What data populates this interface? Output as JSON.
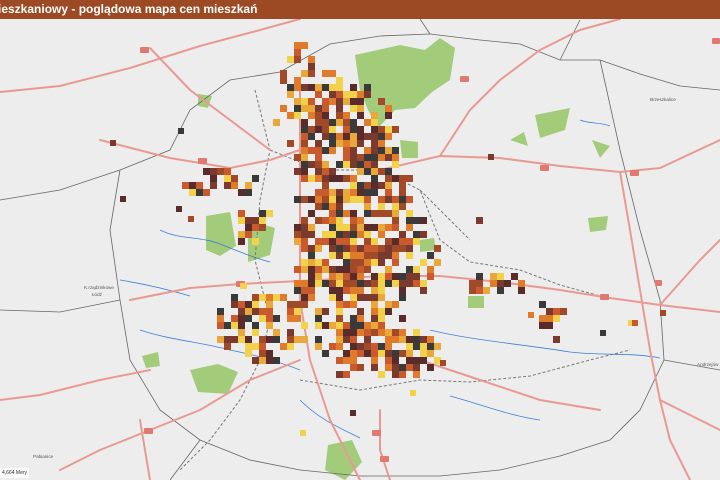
{
  "header": {
    "title": "ieszkaniowy - poglądowa mapa cen mieszkań"
  },
  "map": {
    "scale_text": "4,664 Mery",
    "place_labels": {
      "top_right": "Brzeszkalice",
      "middle_left_1": "K.rządzinkowe",
      "middle_left_2": "Łódź",
      "right": "Andrzejów",
      "bottom_left": "Pabianice"
    },
    "colors": {
      "title_bar": "#9c4a24",
      "background": "#ededed",
      "road": "#e89a92",
      "road_shield": "#e07a70",
      "boundary": "#666666",
      "park": "#a3cc7a",
      "water": "#3d7fd6",
      "price_low": "#e8c53a",
      "price_mid": "#e07b2b",
      "price_high": "#a14a2a",
      "price_top": "#5a2b2b",
      "price_dark": "#2e2e2e"
    },
    "price_palette": [
      "#f2d24a",
      "#e8a83a",
      "#e07b2b",
      "#c85a2d",
      "#a14a2a",
      "#7b3a2e",
      "#5a2b2b",
      "#3a3a3a"
    ]
  }
}
